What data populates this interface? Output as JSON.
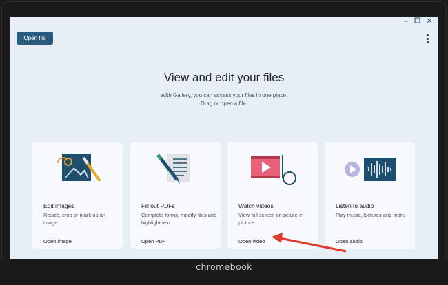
{
  "app": {
    "open_file_button": "Open file",
    "heading": "View and edit your files",
    "subheading_line1": "With Gallery, you can access your files in one place.",
    "subheading_line2": "Drag or open a file."
  },
  "window_controls": [
    "minimize-icon",
    "maximize-icon",
    "close-icon"
  ],
  "cards": [
    {
      "title": "Edit images",
      "desc": "Resize, crop or mark up an image",
      "link": "Open image",
      "icon": "image-edit-icon"
    },
    {
      "title": "Fill out PDFs",
      "desc": "Complete forms, modify files and highlight text",
      "link": "Open PDF",
      "icon": "pdf-pen-icon"
    },
    {
      "title": "Watch videos",
      "desc": "View full screen or picture-in-picture",
      "link": "Open video",
      "icon": "video-play-icon"
    },
    {
      "title": "Listen to audio",
      "desc": "Play music, lectures and more",
      "link": "Open audio",
      "icon": "audio-waveform-icon"
    }
  ],
  "device": {
    "brand": "chromebook"
  },
  "colors": {
    "accent": "#2a5b7c",
    "background": "#e8eef6",
    "card": "#f7f9fc",
    "annotation_arrow": "#e03a2a",
    "pink": "#e8607a"
  }
}
